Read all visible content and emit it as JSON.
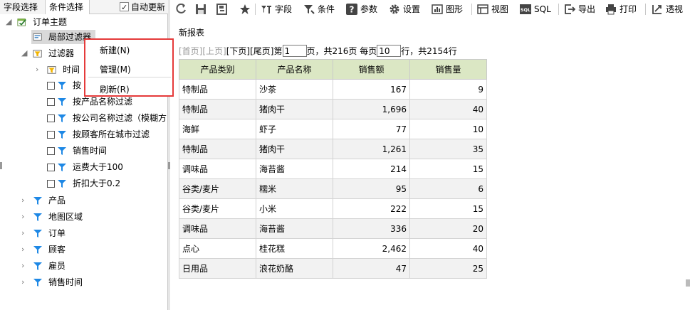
{
  "left_panel": {
    "tabs": [
      "字段选择",
      "条件选择"
    ],
    "auto_update_label": "自动更新",
    "auto_update_checked": true,
    "tree": {
      "root": "订单主题",
      "local_filter": "局部过滤器",
      "filters_group": "过滤器",
      "filter_children": [
        "时间",
        "按",
        "按产品名称过滤",
        "按公司名称过滤（模糊方",
        "按顾客所在城市过滤",
        "销售时间",
        "运费大于100",
        "折扣大于0.2"
      ],
      "groups": [
        "产品",
        "地图区域",
        "订单",
        "顾客",
        "雇员",
        "销售时间"
      ]
    }
  },
  "context_menu": {
    "items": [
      "新建(N)",
      "管理(M)",
      "刷新(R)"
    ],
    "highlight_color": "#e53a3a"
  },
  "toolbar": {
    "field": "字段",
    "condition": "条件",
    "param": "参数",
    "settings": "设置",
    "chart": "图形",
    "view": "视图",
    "sql": "SQL",
    "export": "导出",
    "print": "打印",
    "pivot": "透视"
  },
  "report": {
    "name": "新报表",
    "pager": {
      "first": "[首页]",
      "prev": "[上页]",
      "next": "[下页]",
      "last": "[尾页]",
      "page_prefix": "第",
      "current_page": "1",
      "page_mid": "页，共216页 每页",
      "page_size": "10",
      "rows_suffix": "行，共2154行"
    },
    "columns": [
      "产品类别",
      "产品名称",
      "销售额",
      "销售量"
    ],
    "rows": [
      [
        "特制品",
        "沙茶",
        "167",
        "9"
      ],
      [
        "特制品",
        "猪肉干",
        "1,696",
        "40"
      ],
      [
        "海鲜",
        "虾子",
        "77",
        "10"
      ],
      [
        "特制品",
        "猪肉干",
        "1,261",
        "35"
      ],
      [
        "调味品",
        "海苔酱",
        "214",
        "15"
      ],
      [
        "谷类/麦片",
        "糯米",
        "95",
        "6"
      ],
      [
        "谷类/麦片",
        "小米",
        "222",
        "15"
      ],
      [
        "调味品",
        "海苔酱",
        "336",
        "20"
      ],
      [
        "点心",
        "桂花糕",
        "2,462",
        "40"
      ],
      [
        "日用品",
        "浪花奶酪",
        "47",
        "25"
      ]
    ],
    "header_color": "#dbe7c4"
  }
}
